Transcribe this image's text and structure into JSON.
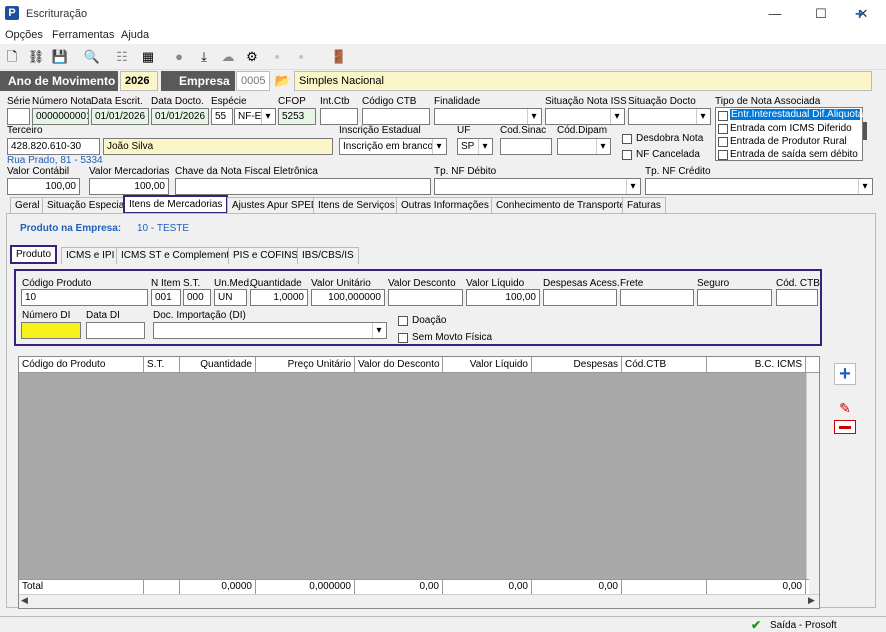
{
  "window": {
    "title": "Escrituração",
    "minimize": "—",
    "maximize": "☐",
    "close": "✕",
    "app_icon": "P"
  },
  "menu": [
    "Opções",
    "Ferramentas",
    "Ajuda"
  ],
  "toolbar_icons": [
    "new-doc-icon",
    "link-icon",
    "save-icon",
    "preview-icon",
    "tree-icon",
    "calc-icon",
    "apple-icon",
    "import-icon",
    "cloud-icon",
    "gear-chip-icon",
    "blank-icon",
    "blank2-icon",
    "exit-door-icon"
  ],
  "header": {
    "ano_label": "Ano de Movimento",
    "ano_value": "2026",
    "empresa_label": "Empresa",
    "empresa_code": "0005",
    "empresa_name": "Simples Nacional",
    "side_plus": "+"
  },
  "nota": {
    "labels": {
      "serie": "Série",
      "numero": "Número Nota",
      "data_escrit": "Data Escrit.",
      "data_docto": "Data Docto.",
      "especie": "Espécie",
      "cfop": "CFOP",
      "int_ctb": "Int.Ctb",
      "codigo_ctb": "Código CTB",
      "finalidade": "Finalidade",
      "situacao_iss": "Situação Nota ISS",
      "situacao_docto": "Situação Docto",
      "tipo_nota": "Tipo de Nota Associada",
      "terceiro": "Terceiro",
      "inscricao": "Inscrição Estadual",
      "uf": "UF",
      "cod_sinac": "Cod.Sinac",
      "cod_dipam": "Cód.Dipam",
      "valor_contabil": "Valor Contábil",
      "valor_mercadorias": "Valor Mercadorias",
      "chave": "Chave da Nota Fiscal Eletrônica",
      "tp_nf_debito": "Tp. NF Débito",
      "tp_nf_credito": "Tp. NF Crédito",
      "desdobra": "Desdobra Nota",
      "nf_cancelada": "NF Cancelada"
    },
    "serie": "",
    "numero": "0000000001",
    "data_escrit": "01/01/2026",
    "data_docto": "01/01/2026",
    "especie_code": "55",
    "especie": "NF-E",
    "cfop": "5253",
    "int_ctb": "",
    "codigo_ctb": "",
    "terceiro_doc": "428.820.610-30",
    "terceiro_nome": "João Silva",
    "endereco": "Rua Prado, 81 - 5334",
    "inscricao": "Inscrição em branco",
    "uf": "SP",
    "valor_contabil": "100,00",
    "valor_mercadorias": "100,00",
    "tipo_nota_options": [
      "Entr.Interestadual Dif.Aliquota",
      "Entrada com ICMS Diferido",
      "Entrada de Produtor Rural",
      "Entrada de saída sem débito"
    ]
  },
  "tabs": [
    "Geral",
    "Situação Especial",
    "Itens de Mercadorias",
    "Ajustes Apur SPED",
    "Itens de Serviços",
    "Outras Informações",
    "Conhecimento de Transporte",
    "Faturas"
  ],
  "produto_empresa": {
    "label": "Produto na Empresa:",
    "value": "10 - TESTE"
  },
  "subtabs": [
    "Produto",
    "ICMS e IPI",
    "ICMS ST e Complemento",
    "PIS e COFINS",
    "IBS/CBS/IS"
  ],
  "produto": {
    "labels": {
      "codigo": "Código Produto",
      "n_item": "N Item",
      "st": "S.T.",
      "un_med": "Un.Med.",
      "quantidade": "Quantidade",
      "valor_unitario": "Valor Unitário",
      "valor_desconto": "Valor Desconto",
      "valor_liquido": "Valor Líquido",
      "despesas": "Despesas Acess.",
      "frete": "Frete",
      "seguro": "Seguro",
      "cod_ctb": "Cód. CTB",
      "numero_di": "Número DI",
      "data_di": "Data DI",
      "doc_importacao": "Doc. Importação (DI)",
      "doacao": "Doação",
      "sem_movto": "Sem Movto Física"
    },
    "codigo": "10",
    "n_item": "001",
    "st": "000",
    "un_med": "UN",
    "quantidade": "1,0000",
    "valor_unitario": "100,000000",
    "valor_liquido": "100,00"
  },
  "grid": {
    "columns": [
      "Código do Produto",
      "S.T.",
      "Quantidade",
      "Preço Unitário",
      "Valor do Desconto",
      "Valor Líquido",
      "Despesas",
      "Cód.CTB",
      "B.C. ICMS"
    ],
    "total_label": "Total",
    "totals": [
      "0,0000",
      "0,000000",
      "0,00",
      "0,00",
      "0,00",
      "0,00"
    ]
  },
  "status": {
    "text": "Saída - Prosoft"
  },
  "colors": {
    "accent_border": "#3b1f7a",
    "header_dark": "#595959",
    "yellow": "#fbf6c8",
    "selected_blue": "#0078d7",
    "link_blue": "#1f5fbf"
  }
}
